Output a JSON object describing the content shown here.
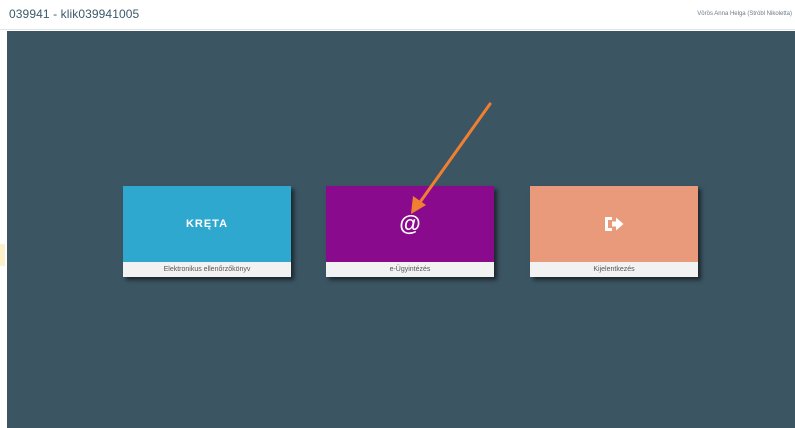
{
  "header": {
    "school_id": "039941 - klik039941005",
    "user": "Vörös Anna Helga (Stróbl Nikoletta)"
  },
  "tiles": [
    {
      "logo_text": "KRĘTA",
      "label": "Elektronikus ellenőrzőkönyv",
      "color": "#2fa8cf",
      "icon": "kreta-logo"
    },
    {
      "icon_glyph": "@",
      "label": "e-Ügyintézés",
      "color": "#8a0a8d",
      "icon": "at-icon"
    },
    {
      "label": "Kijelentkezés",
      "color": "#e89a7b",
      "icon": "logout-icon"
    }
  ],
  "annotation": {
    "arrow_color": "#f07f31",
    "icon": "orange-arrow"
  }
}
